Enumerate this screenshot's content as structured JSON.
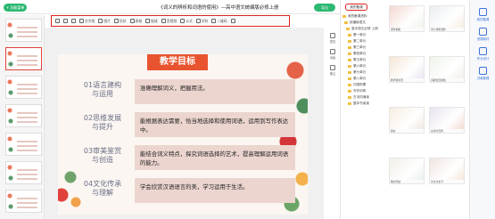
{
  "topbar": {
    "app_button": "+ 功能菜单",
    "doc_title": "《词义的辨析和词语的使用》—高中语文统编版必修上册",
    "export_label": "导出"
  },
  "toolbar": {
    "items": [
      {
        "label": "",
        "icon": "undo-icon"
      },
      {
        "label": "",
        "icon": "redo-icon"
      },
      {
        "label": "",
        "icon": "format-painter-icon"
      },
      {
        "label": "文字框",
        "icon": "textbox-icon"
      },
      {
        "label": "图片",
        "icon": "image-icon"
      },
      {
        "label": "形状",
        "icon": "shape-icon"
      },
      {
        "label": "表格",
        "icon": "table-icon"
      },
      {
        "label": "链接",
        "icon": "link-icon"
      },
      {
        "label": "音视频",
        "icon": "media-icon"
      },
      {
        "label": "公式",
        "icon": "formula-icon"
      },
      {
        "label": "学科",
        "icon": "subject-icon"
      },
      {
        "label": "二维码",
        "icon": "qrcode-icon"
      },
      {
        "label": "",
        "icon": "search-icon"
      }
    ]
  },
  "thumbnails": [
    "1",
    "2",
    "3",
    "4",
    "5",
    "6",
    "7"
  ],
  "slide": {
    "title": "教学目标",
    "rows": [
      {
        "label": "01语言建构\n与运用",
        "text": "准确理解词义，把握用法。"
      },
      {
        "label": "02思维发展\n与提升",
        "text": "能根据表达需要，恰当地选择和使用词语，运用到写作表达中。"
      },
      {
        "label": "03审美鉴赏\n与创造",
        "text": "能结合词义特点，探究词语选择的艺术，提高理解运用词语的能力。"
      },
      {
        "label": "04文化传承\n与理解",
        "text": "学会欣赏汉语语言的美，学习运用于生活。"
      }
    ]
  },
  "mini_tools": [
    {
      "label": "属性",
      "icon": "properties-icon"
    },
    {
      "label": "动画",
      "icon": "animation-icon"
    },
    {
      "label": "备注",
      "icon": "notes-icon"
    }
  ],
  "panel": {
    "tab_label": "我的备课",
    "tree": [
      "我的备课资料",
      "统编版语文",
      "高中语文必修 上册",
      "第一单元",
      "第二单元",
      "第三单元",
      "第四单元",
      "第五单元",
      "第六单元",
      "第七单元",
      "第八单元",
      "词语积累",
      "写作训练",
      "古诗词诵读",
      "整本书阅读"
    ],
    "resources": [
      "课件模板",
      "词义辨析课件",
      "教学目标页",
      "诗歌鉴赏模板",
      "静女",
      "古诗文赏析",
      "散文阅读",
      "文言文复习"
    ]
  },
  "rail": [
    {
      "label": "我的备课",
      "icon": "pen-icon"
    },
    {
      "label": "资源素材",
      "icon": "resources-icon"
    },
    {
      "label": "作业设计",
      "icon": "homework-icon"
    },
    {
      "label": "试卷管理",
      "icon": "exam-icon"
    }
  ]
}
